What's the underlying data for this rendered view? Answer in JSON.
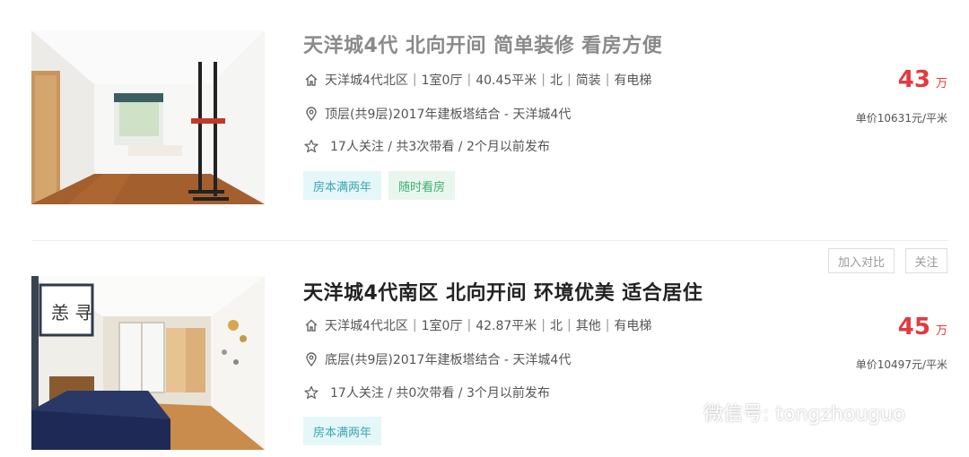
{
  "listings": [
    {
      "title": "天洋城4代 北向开间 简单装修 看房方便",
      "community": "天洋城4代北区",
      "layout": "1室0厅",
      "area": "40.45平米",
      "orientation": "北",
      "decoration": "简装",
      "elevator": "有电梯",
      "floor_info": "顶层(共9层)2017年建板塔结合 - 天洋城4代",
      "followers_info": "17人关注 / 共3次带看 / 2个月以前发布",
      "tags": [
        "房本满两年",
        "随时看房"
      ],
      "price": "43",
      "price_unit": "万",
      "unit_price": "单价10631元/平米"
    },
    {
      "title": "天洋城4代南区 北向开间 环境优美 适合居住",
      "community": "天洋城4代北区",
      "layout": "1室0厅",
      "area": "42.87平米",
      "orientation": "北",
      "decoration": "其他",
      "elevator": "有电梯",
      "floor_info": "底层(共9层)2017年建板塔结合 - 天洋城4代",
      "followers_info": "17人关注 / 共0次带看 / 3个月以前发布",
      "tags": [
        "房本满两年"
      ],
      "price": "45",
      "price_unit": "万",
      "unit_price": "单价10497元/平米"
    }
  ],
  "actions": {
    "compare_label": "加入对比",
    "follow_label": "关注"
  },
  "watermark": {
    "text": "微信号: tongzhouguo"
  },
  "icons": {
    "house": "house-icon",
    "location": "location-pin-icon",
    "star": "star-icon",
    "wechat": "wechat-icon"
  },
  "colors": {
    "price": "#e4393c",
    "tag_blue_bg": "#e6f7f9",
    "tag_blue_text": "#3aa6b4",
    "tag_green_bg": "#e8f6ee",
    "tag_green_text": "#3fae70"
  }
}
